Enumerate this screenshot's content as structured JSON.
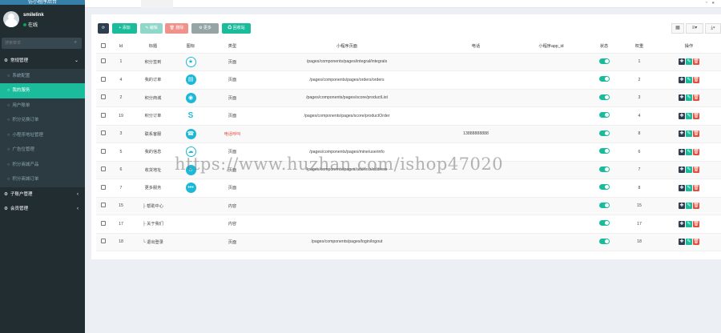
{
  "app": {
    "brand": "仿小程序后台"
  },
  "user": {
    "name": "smilelink",
    "status": "在线"
  },
  "search": {
    "placeholder": "搜索菜单"
  },
  "menu": [
    {
      "label": "常规管理",
      "level": "top",
      "caret": "⌄"
    },
    {
      "label": "系统配置",
      "level": "sub"
    },
    {
      "label": "我的服务",
      "level": "sub",
      "active": true
    },
    {
      "label": "用户账单",
      "level": "sub"
    },
    {
      "label": "积分兑换订单",
      "level": "sub"
    },
    {
      "label": "小程序地址管理",
      "level": "sub"
    },
    {
      "label": "广告位管理",
      "level": "sub"
    },
    {
      "label": "积分商城产品",
      "level": "sub"
    },
    {
      "label": "积分商城订单",
      "level": "sub"
    },
    {
      "label": "子账户管理",
      "level": "top",
      "caret": "‹"
    },
    {
      "label": "会员管理",
      "level": "top",
      "caret": "‹"
    }
  ],
  "toolbar": {
    "refresh": "⟳",
    "add": "+ 添加",
    "edit": "✎ 编辑",
    "delete": "🗑 删除",
    "more": "⚙ 更多",
    "recycle": "♻ 回收站"
  },
  "table": {
    "headers": [
      "",
      "Id",
      "标题",
      "图标",
      "类型",
      "小程序页面",
      "电话",
      "小程序app_id",
      "状态",
      "权重",
      "操作"
    ],
    "rows": [
      {
        "id": "1",
        "title": "积分签到",
        "icon": "★",
        "icon_style": "outline",
        "type": "页面",
        "path": "/pages/components/pages/integral/integrals",
        "phone": "",
        "appid": "",
        "weight": "1"
      },
      {
        "id": "4",
        "title": "我的订单",
        "icon": "▤",
        "icon_style": "fill",
        "type": "页面",
        "path": "/pages/components/pages/orders/orders",
        "phone": "",
        "appid": "",
        "weight": "2"
      },
      {
        "id": "2",
        "title": "积分商城",
        "icon": "◉",
        "icon_style": "fill",
        "type": "页面",
        "path": "/pages/components/pages/score/productList",
        "phone": "",
        "appid": "",
        "weight": "3"
      },
      {
        "id": "19",
        "title": "积分订单",
        "icon": "S",
        "icon_style": "plain",
        "type": "页面",
        "path": "/pages/components/pages/score/productOrder",
        "phone": "",
        "appid": "",
        "weight": "4"
      },
      {
        "id": "3",
        "title": "联系客服",
        "icon": "☎",
        "icon_style": "fill",
        "type": "电话呼叫",
        "type_red": true,
        "path": "",
        "phone": "13888888888",
        "appid": "",
        "weight": "8"
      },
      {
        "id": "5",
        "title": "我的信息",
        "icon": "☁",
        "icon_style": "outline",
        "type": "页面",
        "path": "/pages/components/pages/mine/userinfo",
        "phone": "",
        "appid": "",
        "weight": "6"
      },
      {
        "id": "6",
        "title": "收货地址",
        "icon": "⌂",
        "icon_style": "fill",
        "type": "页面",
        "path": "/pages/components/pages/address/address",
        "phone": "",
        "appid": "",
        "weight": "7"
      },
      {
        "id": "7",
        "title": "更多服务",
        "icon": "•••",
        "icon_style": "fill",
        "type": "页面",
        "path": "",
        "phone": "",
        "appid": "",
        "weight": "8"
      },
      {
        "id": "15",
        "title": "├ 帮助中心",
        "icon": "",
        "icon_style": "none",
        "type": "内容",
        "path": "",
        "phone": "",
        "appid": "",
        "weight": "15"
      },
      {
        "id": "17",
        "title": "├ 关于我们",
        "icon": "",
        "icon_style": "none",
        "type": "内容",
        "path": "",
        "phone": "",
        "appid": "",
        "weight": "17"
      },
      {
        "id": "18",
        "title": "└ 退出登录",
        "icon": "",
        "icon_style": "none",
        "type": "页面",
        "path": "/pages/components/pages/login/logout",
        "phone": "",
        "appid": "",
        "weight": "18"
      }
    ]
  },
  "watermark": "https://www.huzhan.com/ishop47020",
  "colors": {
    "sidebar": "#222d32",
    "accent": "#1abc9c",
    "danger": "#e74c3c",
    "dark": "#2c3e50"
  }
}
